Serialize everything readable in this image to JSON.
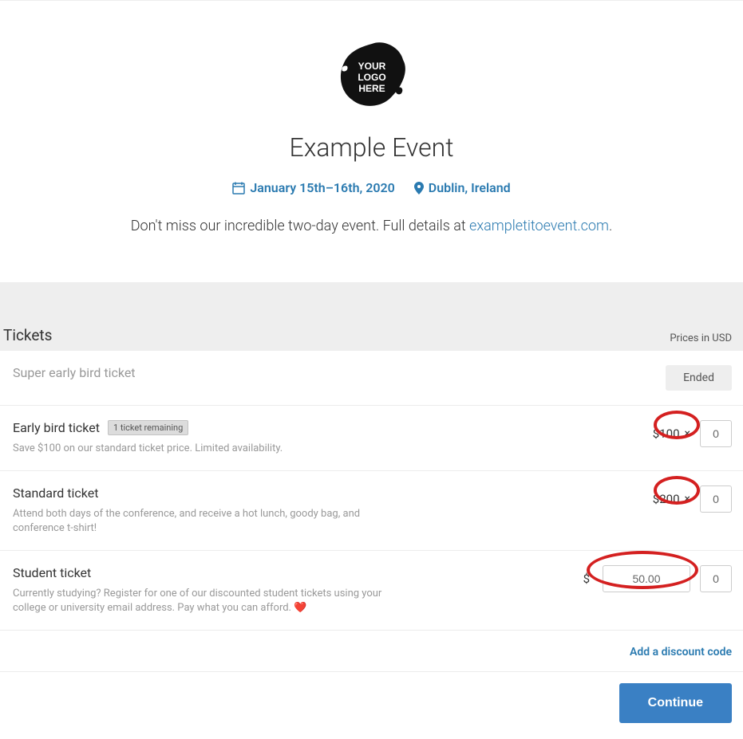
{
  "header": {
    "logo_text_line1": "YOUR",
    "logo_text_line2": "LOGO",
    "logo_text_line3": "HERE",
    "title": "Example Event",
    "date_text": "January 15th–16th, 2020",
    "location_text": "Dublin, Ireland",
    "description_prefix": "Don't miss our incredible two-day event. Full details at ",
    "description_link_text": "exampletitoevent.com",
    "description_suffix": "."
  },
  "tickets_section": {
    "title": "Tickets",
    "prices_label": "Prices in USD"
  },
  "tickets": [
    {
      "name": "Super early bird ticket",
      "status": "ended",
      "status_label": "Ended"
    },
    {
      "name": "Early bird ticket",
      "badge": "1 ticket remaining",
      "description": "Save $100 on our standard ticket price. Limited availability.",
      "price": "$100",
      "qty": "0"
    },
    {
      "name": "Standard ticket",
      "description": "Attend both days of the conference, and receive a hot lunch, goody bag, and conference t-shirt!",
      "price": "$200",
      "qty": "0"
    },
    {
      "name": "Student ticket",
      "description_prefix": "Currently studying? Register for one of our discounted student tickets using your college or university email address. Pay what you can afford. ",
      "heart": "❤️",
      "currency": "$",
      "price_input": "50.00",
      "qty": "0"
    }
  ],
  "discount": {
    "link_text": "Add a discount code"
  },
  "actions": {
    "continue_label": "Continue"
  }
}
